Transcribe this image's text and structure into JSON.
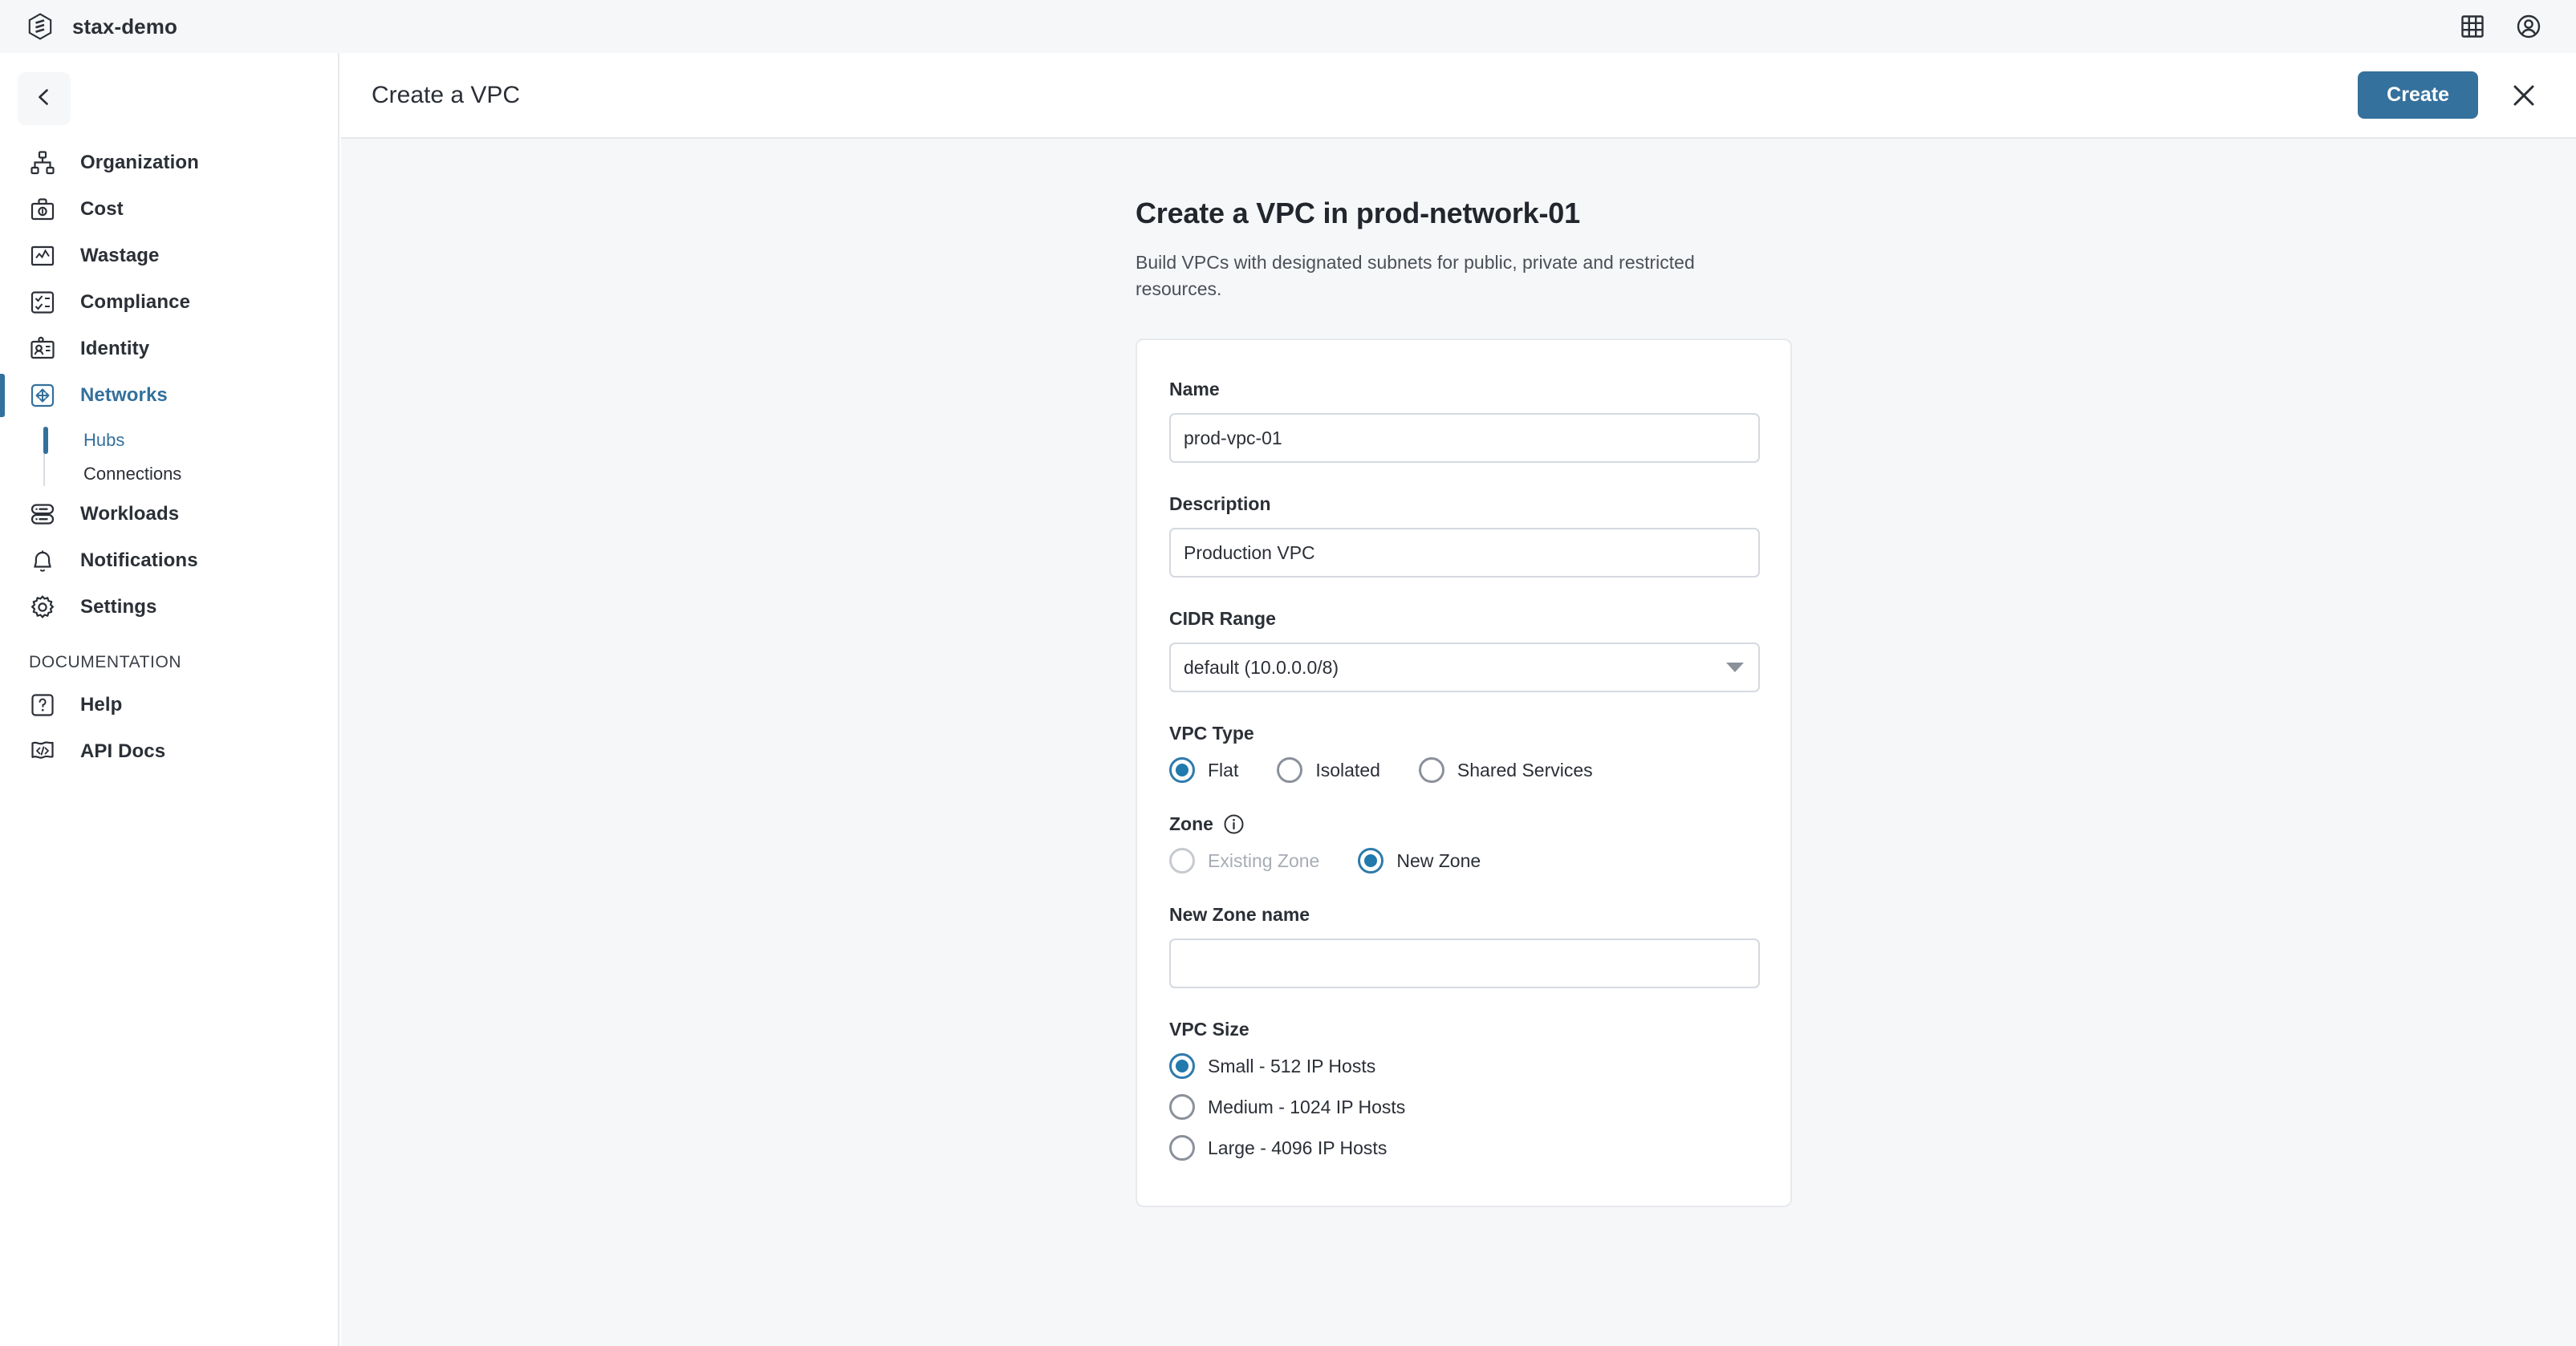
{
  "appbar": {
    "brand_name": "stax-demo",
    "logo_icon": "stax-hexagon-logo",
    "apps_icon": "grid-apps-icon",
    "account_icon": "user-account-icon"
  },
  "sidebar": {
    "back_icon": "chevron-left-icon",
    "items": [
      {
        "label": "Organization",
        "icon": "org-chart-icon",
        "active": false
      },
      {
        "label": "Cost",
        "icon": "briefcase-dollar-icon",
        "active": false
      },
      {
        "label": "Wastage",
        "icon": "chart-line-box-icon",
        "active": false
      },
      {
        "label": "Compliance",
        "icon": "checklist-icon",
        "active": false
      },
      {
        "label": "Identity",
        "icon": "id-badge-icon",
        "active": false
      },
      {
        "label": "Networks",
        "icon": "move-arrows-box-icon",
        "active": true
      }
    ],
    "subitems": [
      {
        "label": "Hubs",
        "active": true
      },
      {
        "label": "Connections",
        "active": false
      }
    ],
    "items_lower": [
      {
        "label": "Workloads",
        "icon": "server-stack-icon",
        "active": false
      },
      {
        "label": "Notifications",
        "icon": "bell-icon",
        "active": false
      },
      {
        "label": "Settings",
        "icon": "gear-icon",
        "active": false
      }
    ],
    "section_title": "DOCUMENTATION",
    "docs_items": [
      {
        "label": "Help",
        "icon": "question-box-icon",
        "active": false
      },
      {
        "label": "API Docs",
        "icon": "code-flag-icon",
        "active": false
      }
    ]
  },
  "header": {
    "title": "Create a VPC",
    "create_label": "Create",
    "close_icon": "close-x-icon"
  },
  "form": {
    "heading": "Create a VPC in prod-network-01",
    "subheading": "Build VPCs with designated subnets for public, private and restricted resources.",
    "name": {
      "label": "Name",
      "value": "prod-vpc-01",
      "placeholder": ""
    },
    "description": {
      "label": "Description",
      "value": "Production VPC",
      "placeholder": ""
    },
    "cidr": {
      "label": "CIDR Range",
      "value": "default (10.0.0.0/8)",
      "caret_icon": "chevron-down-icon"
    },
    "vpc_type": {
      "label": "VPC Type",
      "options": [
        {
          "label": "Flat",
          "checked": true,
          "disabled": false
        },
        {
          "label": "Isolated",
          "checked": false,
          "disabled": false
        },
        {
          "label": "Shared Services",
          "checked": false,
          "disabled": false
        }
      ]
    },
    "zone": {
      "label": "Zone",
      "info_icon": "info-circle-icon",
      "options": [
        {
          "label": "Existing Zone",
          "checked": false,
          "disabled": true
        },
        {
          "label": "New Zone",
          "checked": true,
          "disabled": false
        }
      ]
    },
    "new_zone_name": {
      "label": "New Zone name",
      "value": "",
      "placeholder": ""
    },
    "vpc_size": {
      "label": "VPC Size",
      "options": [
        {
          "label": "Small - 512 IP Hosts",
          "checked": true,
          "disabled": false
        },
        {
          "label": "Medium - 1024 IP Hosts",
          "checked": false,
          "disabled": false
        },
        {
          "label": "Large - 4096 IP Hosts",
          "checked": false,
          "disabled": false
        }
      ]
    }
  },
  "colors": {
    "accent": "#35719d",
    "accent_radio": "#2179ac",
    "page_bg": "#f6f7f9",
    "card_bg": "#ffffff",
    "border": "#e7e9ed",
    "text": "#2b2f36",
    "muted_text": "#a7acb4"
  }
}
